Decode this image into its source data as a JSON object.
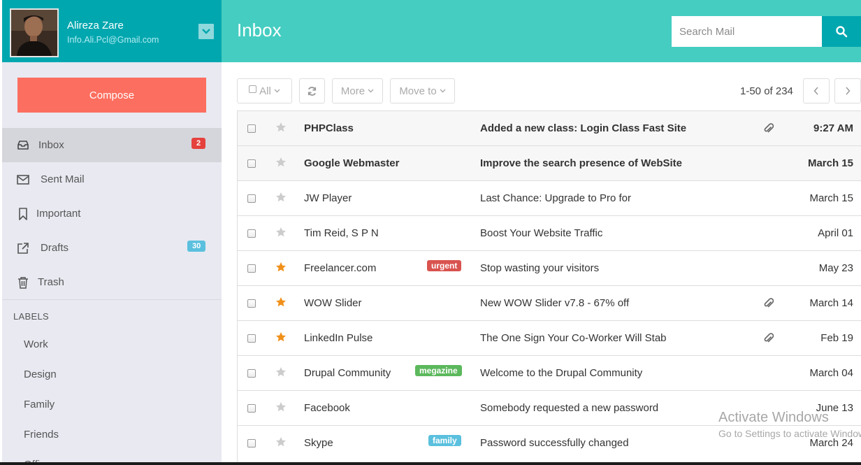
{
  "profile": {
    "name": "Alireza Zare",
    "email": "Info.Ali.Pcl@Gmail.com"
  },
  "compose_label": "Compose",
  "nav": [
    {
      "label": "Inbox",
      "icon": "inbox-icon",
      "badge": "2",
      "badge_color": "#e5413d",
      "active": true
    },
    {
      "label": "Sent Mail",
      "icon": "envelope-icon",
      "badge": "",
      "active": false
    },
    {
      "label": "Important",
      "icon": "bookmark-icon",
      "badge": "",
      "active": false
    },
    {
      "label": "Drafts",
      "icon": "external-link-icon",
      "badge": "30",
      "badge_color": "#5bc0de",
      "active": false
    },
    {
      "label": "Trash",
      "icon": "trash-icon",
      "badge": "",
      "active": false
    }
  ],
  "labels_heading": "LABELS",
  "labels": [
    "Work",
    "Design",
    "Family",
    "Friends",
    "Office"
  ],
  "header": {
    "title": "Inbox",
    "search_placeholder": "Search Mail"
  },
  "toolbar": {
    "all_label": "All",
    "more_label": "More",
    "move_label": "Move to",
    "pagination": "1-50 of 234"
  },
  "colors": {
    "header": "#45cdc1",
    "profile": "#01a7af",
    "compose": "#fc6e5f",
    "sidebar": "#e8e9f1",
    "star_active": "#f0901a",
    "star_inactive": "#cccccc"
  },
  "emails": [
    {
      "sender": "PHPClass",
      "subject": "Added a new class: Login Class Fast Site",
      "date": "9:27 AM",
      "unread": true,
      "starred": false,
      "attachment": true,
      "tag": ""
    },
    {
      "sender": "Google Webmaster",
      "subject": "Improve the search presence of WebSite",
      "date": "March 15",
      "unread": true,
      "starred": false,
      "attachment": false,
      "tag": ""
    },
    {
      "sender": "JW Player",
      "subject": "Last Chance: Upgrade to Pro for",
      "date": "March 15",
      "unread": false,
      "starred": false,
      "attachment": false,
      "tag": ""
    },
    {
      "sender": "Tim Reid, S P N",
      "subject": "Boost Your Website Traffic",
      "date": "April 01",
      "unread": false,
      "starred": false,
      "attachment": false,
      "tag": ""
    },
    {
      "sender": "Freelancer.com",
      "subject": "Stop wasting your visitors",
      "date": "May 23",
      "unread": false,
      "starred": true,
      "attachment": false,
      "tag": "urgent",
      "tag_color": "#d9534f"
    },
    {
      "sender": "WOW Slider",
      "subject": "New WOW Slider v7.8 - 67% off",
      "date": "March 14",
      "unread": false,
      "starred": true,
      "attachment": true,
      "tag": ""
    },
    {
      "sender": "LinkedIn Pulse",
      "subject": "The One Sign Your Co-Worker Will Stab",
      "date": "Feb 19",
      "unread": false,
      "starred": true,
      "attachment": true,
      "tag": ""
    },
    {
      "sender": "Drupal Community",
      "subject": "Welcome to the Drupal Community",
      "date": "March 04",
      "unread": false,
      "starred": false,
      "attachment": false,
      "tag": "megazine",
      "tag_color": "#5cb85c"
    },
    {
      "sender": "Facebook",
      "subject": "Somebody requested a new password",
      "date": "June 13",
      "unread": false,
      "starred": false,
      "attachment": false,
      "tag": ""
    },
    {
      "sender": "Skype",
      "subject": "Password successfully changed",
      "date": "March 24",
      "unread": false,
      "starred": false,
      "attachment": false,
      "tag": "family",
      "tag_color": "#5bc0de"
    }
  ],
  "watermark": {
    "title": "Activate Windows",
    "subtitle": "Go to Settings to activate Windows."
  }
}
